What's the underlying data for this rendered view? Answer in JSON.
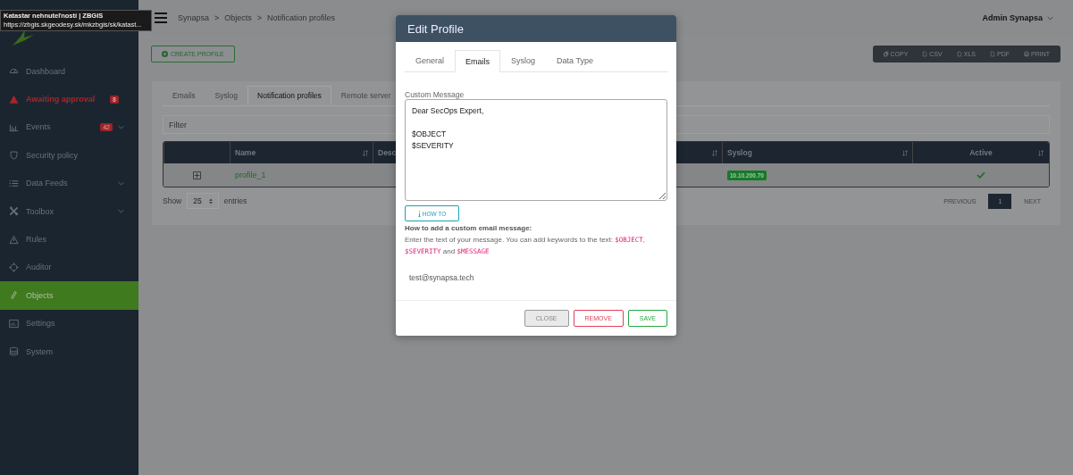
{
  "tooltip": {
    "title": "Katastar nehnuteľností | ZBGIS",
    "url": "https://zbgis.skgeodesy.sk/mkzbgis/sk/katast..."
  },
  "sidebar": {
    "items": [
      {
        "label": "Dashboard",
        "kind": "normal",
        "selected": false
      },
      {
        "label": "Awaiting approval",
        "kind": "alert",
        "badge": "8",
        "selected": false
      },
      {
        "label": "Events",
        "kind": "normal",
        "badge": "42",
        "expandable": true,
        "selected": false
      },
      {
        "label": "Security policy",
        "kind": "normal",
        "selected": false
      },
      {
        "label": "Data Feeds",
        "kind": "normal",
        "expandable": true,
        "selected": false
      },
      {
        "label": "Toolbox",
        "kind": "normal",
        "expandable": true,
        "selected": false
      },
      {
        "label": "Rules",
        "kind": "normal",
        "selected": false
      },
      {
        "label": "Auditor",
        "kind": "normal",
        "selected": false
      },
      {
        "label": "Objects",
        "kind": "normal",
        "selected": true
      },
      {
        "label": "Settings",
        "kind": "normal",
        "selected": false
      },
      {
        "label": "System",
        "kind": "normal",
        "selected": false
      }
    ]
  },
  "breadcrumbs": [
    "Synapsa",
    ">",
    "Objects",
    ">",
    "Notification profiles"
  ],
  "user": "Admin Synapsa",
  "create_button": "CREATE PROFILE",
  "export_buttons": [
    "COPY",
    "CSV",
    "XLS",
    "PDF",
    "PRINT"
  ],
  "tabs": [
    {
      "label": "Emails",
      "selected": false
    },
    {
      "label": "Syslog",
      "selected": false
    },
    {
      "label": "Notification profiles",
      "selected": true
    },
    {
      "label": "Remote server",
      "selected": false
    }
  ],
  "filter": {
    "placeholder": "Filter"
  },
  "table": {
    "columns": [
      "",
      "Name",
      "Desc",
      "",
      "Syslog",
      "Active"
    ],
    "rows": [
      {
        "name": "profile_1",
        "syslog": "10.10.200.70",
        "active": true
      }
    ]
  },
  "show_entries": {
    "prefix": "Show",
    "value": "25",
    "suffix": "entries"
  },
  "pagination": {
    "previous": "PREVIOUS",
    "pages": [
      {
        "label": "1",
        "selected": true
      }
    ],
    "next": "NEXT"
  },
  "modal": {
    "title": "Edit Profile",
    "tabs": [
      {
        "label": "General",
        "selected": false
      },
      {
        "label": "Emails",
        "selected": true
      },
      {
        "label": "Syslog",
        "selected": false
      },
      {
        "label": "Data Type",
        "selected": false
      }
    ],
    "message_label": "Custom Message",
    "message": "Dear SecOps Expert,\n\n$OBJECT\n$SEVERITY",
    "howto_button": "HOW TO",
    "help_title": "How to add a custom email message:",
    "help_text": [
      {
        "kind": "plain",
        "text": "Enter the text of your message. You can add keywords to the text: "
      },
      {
        "kind": "code",
        "text": "$OBJECT"
      },
      {
        "kind": "plain",
        "text": ", "
      },
      {
        "kind": "code",
        "text": "$SEVERITY"
      },
      {
        "kind": "plain",
        "text": " and "
      },
      {
        "kind": "code",
        "text": "$MESSAGE"
      }
    ],
    "email": "test@synapsa.tech",
    "buttons": [
      {
        "label": "CLOSE",
        "kind": "close"
      },
      {
        "label": "REMOVE",
        "kind": "remove"
      },
      {
        "label": "SAVE",
        "kind": "save"
      }
    ]
  }
}
